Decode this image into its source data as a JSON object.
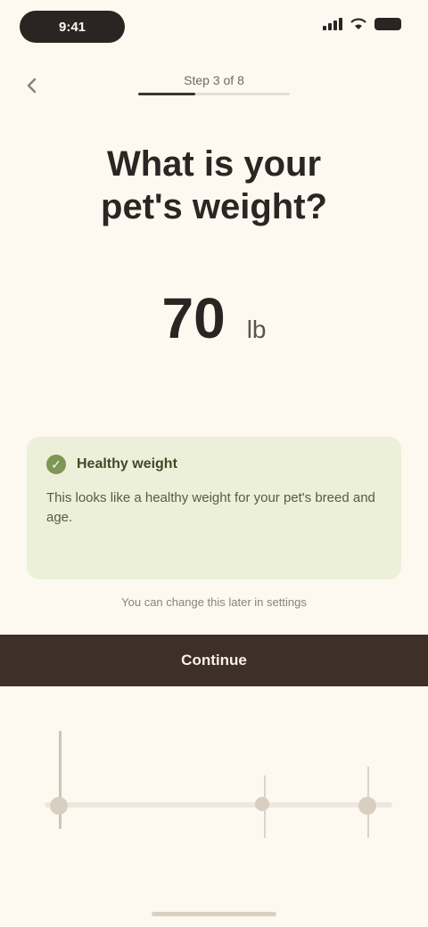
{
  "status_bar": {
    "time": "9:41",
    "icons": [
      "signal-icon",
      "wifi-icon",
      "battery-icon"
    ]
  },
  "header": {
    "back_icon": "chevron-left-icon",
    "step_label": "Step 3 of 8",
    "progress": 0.375
  },
  "question": {
    "line1": "What is your",
    "line2": "pet's weight?"
  },
  "value": {
    "number": "70",
    "unit": "lb"
  },
  "info_card": {
    "icon": "check-circle-icon",
    "title": "Healthy weight",
    "body": "This looks like a healthy weight for your pet's breed and age."
  },
  "note": "You can change this later in settings",
  "cta": {
    "label": "Continue"
  },
  "colors": {
    "background": "#fdf9f0",
    "primary_button": "#3e3029",
    "info_card": "#ecf0d9",
    "accent_green": "#7e9656"
  }
}
